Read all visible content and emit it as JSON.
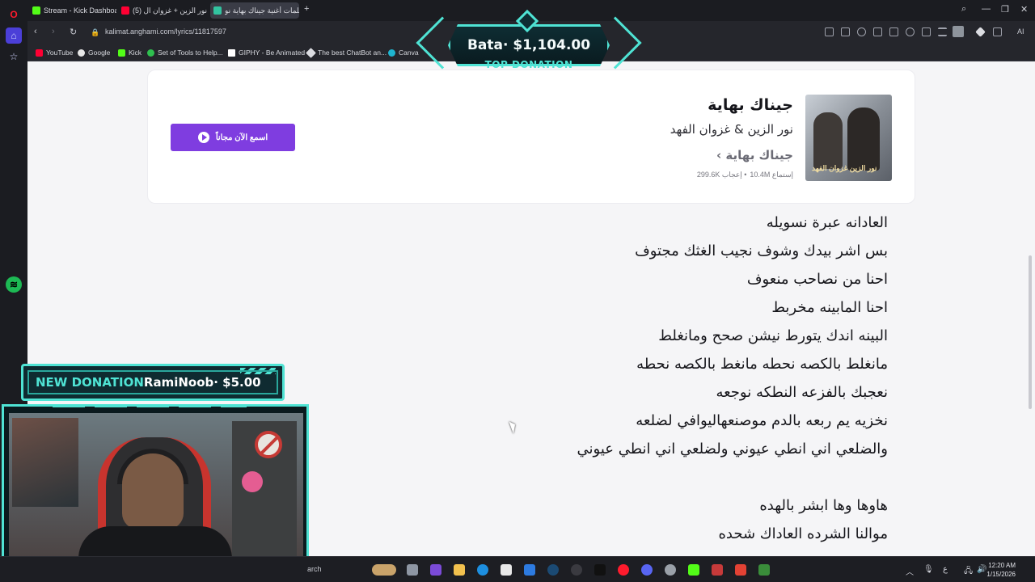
{
  "browser": {
    "tabs": [
      {
        "label": "Stream - Kick Dashboard",
        "color": "#53fc18"
      },
      {
        "label": "(5) نور الزين + غزوان ال",
        "color": "#ff0033"
      },
      {
        "label": "كلمات أغنية جيناك بهاية نو",
        "color": "#32c3a0"
      }
    ],
    "url": "kalimat.anghami.com/lyrics/11817597",
    "bookmarks": [
      "YouTube",
      "Google",
      "Kick",
      "Set of Tools to Help...",
      "GIPHY - Be Animated",
      "The best ChatBot an...",
      "Canva"
    ],
    "ai_label": "AI"
  },
  "song": {
    "title": "جيناك بهاية",
    "artists": "نور الزين & غزوان الفهد",
    "album": "جيناك بهاية ›",
    "plays": "إستماع 10.4M",
    "likes": "• إعجاب 299.6K",
    "listen_button": "اسمع الآن مجاناً",
    "cover_text": "نور الزين غزوان الفهد"
  },
  "lyrics": [
    "العادانه عبرة نسويله",
    "بس اشر بيدك وشوف نجيب الغثك مجتوف",
    "احنا من نصاحب منعوف",
    "احنا المابينه مخربط",
    "البينه اندك يتورط نيشن صحح ومانغلط",
    "مانغلط بالكصه نحطه مانغط بالكصه نحطه",
    "نعجبك بالفزعه النطكه نوجعه",
    "نخزيه يم ربعه بالدم موصنعهاليوافي لضلعه",
    "والضلعي اني انطي عيوني ولضلعي اني انطي عيوني",
    "",
    "هاوها وها ابشر بالهده",
    "موالنا الشرده العاداك شحده"
  ],
  "overlay": {
    "top_donation_amount": "Bata· $1,104.00",
    "top_donation_label": "TOP DONATION",
    "new_donation_label": "NEW DONATION",
    "new_donation_message": "RamiNoob· $5.00"
  },
  "taskbar": {
    "search_text": "arch",
    "time": "12:20 AM",
    "date": "1/15/2026",
    "lang": "ع"
  }
}
